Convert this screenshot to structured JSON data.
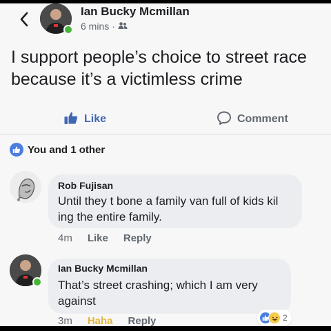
{
  "post": {
    "author": "Ian Bucky Mcmillan",
    "time": "6 mins",
    "separator": "·",
    "text": "I support people’s choice to street race because it’s a victimless crime",
    "like_label": "Like",
    "comment_label": "Comment",
    "reactions_summary": "You and 1 other"
  },
  "comments": [
    {
      "name": "Rob Fujisan",
      "text": "Until they t bone a family van full of kids kil ing the entire family.",
      "time": "4m",
      "like_label": "Like",
      "reply_label": "Reply"
    },
    {
      "name": "Ian Bucky Mcmillan",
      "text": "That’s street crashing; which I am very against",
      "time": "3m",
      "reaction_label": "Haha",
      "reply_label": "Reply",
      "reaction_count": "2"
    }
  ],
  "colors": {
    "like_blue": "#4267b2",
    "online_green": "#44b536",
    "haha_yellow": "#e3b53b"
  },
  "icons": [
    "back-chevron-icon",
    "friends-icon",
    "thumbs-up-icon",
    "comment-icon",
    "haha-icon"
  ]
}
